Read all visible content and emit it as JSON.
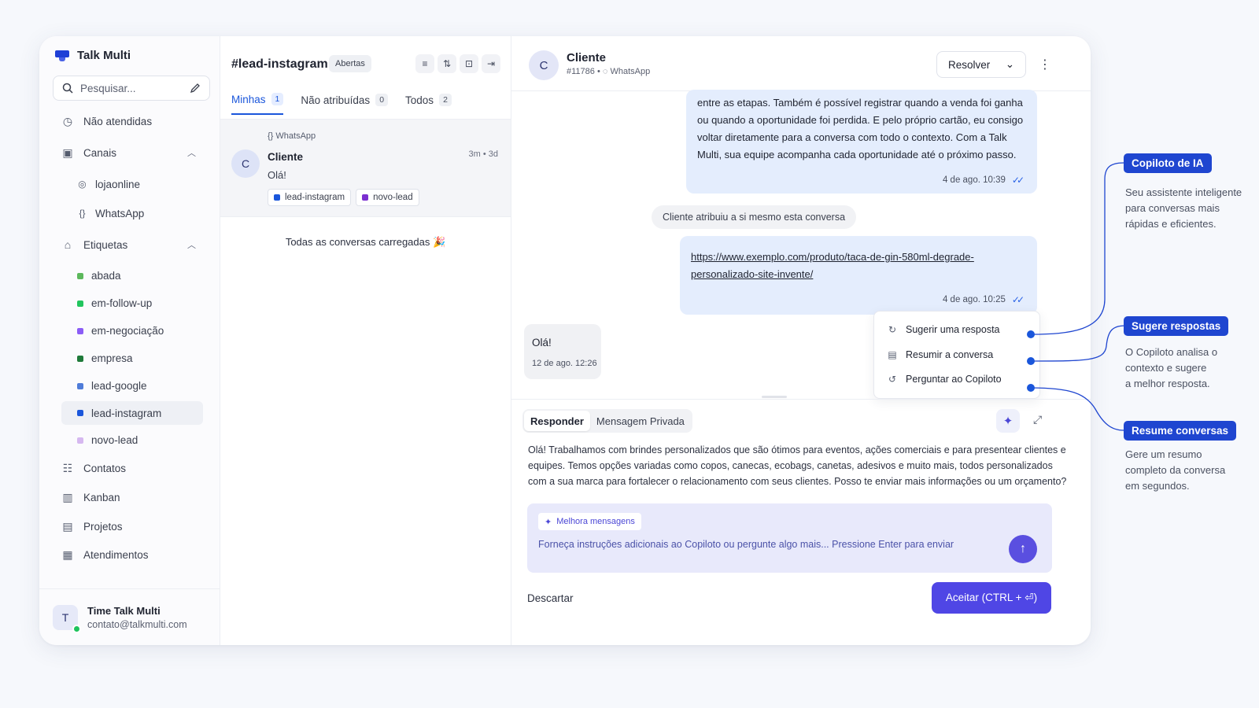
{
  "brand": {
    "name": "Talk Multi"
  },
  "sidebar": {
    "search_placeholder": "Pesquisar...",
    "items": {
      "unattended": "Não atendidas",
      "channels": "Canais",
      "labels": "Etiquetas",
      "contacts": "Contatos",
      "kanban": "Kanban",
      "projects": "Projetos",
      "services": "Atendimentos"
    },
    "channels": [
      {
        "label": "lojaonline",
        "icon": "instagram-icon"
      },
      {
        "label": "WhatsApp",
        "icon": "braces-icon"
      }
    ],
    "labels": [
      {
        "label": "abada",
        "color": "#5cb85c"
      },
      {
        "label": "em-follow-up",
        "color": "#22c55e"
      },
      {
        "label": "em-negociação",
        "color": "#8b5cf6"
      },
      {
        "label": "empresa",
        "color": "#1f7a3a"
      },
      {
        "label": "lead-google",
        "color": "#4f7cd9"
      },
      {
        "label": "lead-instagram",
        "color": "#1a56db"
      },
      {
        "label": "novo-lead",
        "color": "#d6b8f0"
      }
    ],
    "footer": {
      "initial": "T",
      "name": "Time Talk Multi",
      "email": "contato@talkmulti.com"
    }
  },
  "convlist": {
    "title": "#lead-instagram",
    "status_badge": "Abertas",
    "tabs": [
      {
        "label": "Minhas",
        "count": "1"
      },
      {
        "label": "Não atribuídas",
        "count": "0"
      },
      {
        "label": "Todos",
        "count": "2"
      }
    ],
    "conversation": {
      "channel": "WhatsApp",
      "initial": "C",
      "name": "Cliente",
      "time": "3m • 3d",
      "message": "Olá!",
      "tags": [
        {
          "label": "lead-instagram",
          "color": "#1a56db"
        },
        {
          "label": "novo-lead",
          "color": "#7b2fd0"
        }
      ]
    },
    "all_loaded": "Todas as conversas carregadas 🎉"
  },
  "chat": {
    "contact": {
      "initial": "C",
      "name": "Cliente",
      "id": "#11786",
      "channel": "WhatsApp"
    },
    "resolve_label": "Resolver",
    "messages": {
      "out1_text": "entre as etapas. Também é possível registrar quando a venda foi ganha ou quando a oportunidade foi perdida. E pelo próprio cartão, eu consigo voltar diretamente para a conversa com todo o contexto. Com a Talk Multi, sua equipe acompanha cada oportunidade até o próximo passo.",
      "out1_time": "4 de ago. 10:39",
      "system_note": "Cliente atribuiu a si mesmo esta conversa",
      "out2_link": "https://www.exemplo.com/produto/taca-de-gin-580ml-degrade-personalizado-site-invente/",
      "out2_time": "4 de ago. 10:25",
      "in1_text": "Olá!",
      "in1_time": "12 de ago. 12:26"
    },
    "copilot_menu": [
      {
        "label": "Sugerir uma resposta",
        "icon": "reply-icon"
      },
      {
        "label": "Resumir a conversa",
        "icon": "document-icon"
      },
      {
        "label": "Perguntar ao Copiloto",
        "icon": "refresh-icon"
      }
    ],
    "composer": {
      "mode_reply": "Responder",
      "mode_private": "Mensagem Privada",
      "reply_text": "Olá! Trabalhamos com brindes personalizados que são ótimos para eventos, ações comerciais e para presentear clientes e equipes. Temos opções variadas como copos, canecas, ecobags, canetas, adesivos e muito mais, todos personalizados com a sua marca para fortalecer o relacionamento com seus clientes. Posso te enviar mais informações ou um orçamento?",
      "improve_chip": "Melhora mensagens",
      "copilot_placeholder": "Forneça instruções adicionais ao Copiloto ou pergunte algo mais... Pressione Enter para enviar",
      "discard": "Descartar",
      "accept": "Aceitar (CTRL + ⏎)"
    }
  },
  "callouts": [
    {
      "label": "Copiloto de IA",
      "desc": "Seu assistente inteligente\npara conversas mais\nrápidas e eficientes."
    },
    {
      "label": "Sugere respostas",
      "desc": "O Copiloto analisa o\ncontexto e sugere\na melhor resposta."
    },
    {
      "label": "Resume conversas",
      "desc": "Gere um resumo\ncompleto da conversa\nem segundos."
    }
  ],
  "colors": {
    "accent": "#1a56db",
    "callout": "#1f46d0",
    "primary_button": "#4f46e5",
    "bubble_out": "#e4edfd",
    "copilot_box": "#e8e9fb"
  }
}
